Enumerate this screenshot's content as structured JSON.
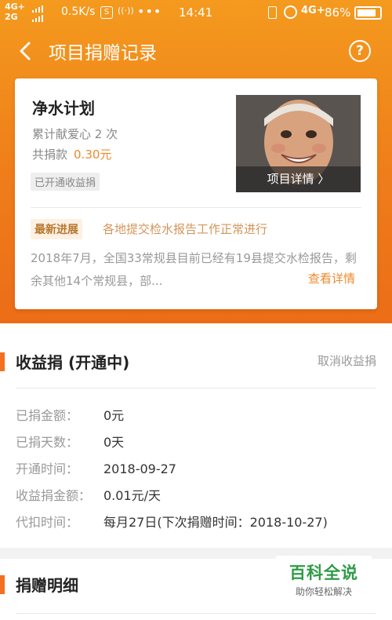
{
  "status_bar": {
    "network_top": "4G+",
    "network_bottom": "2G",
    "speed": "0.5K/s",
    "icon1": "S",
    "icon2": "((·))",
    "dots": "•••",
    "time": "14:41",
    "signal_right": "4G+",
    "battery_pct": "86%",
    "battery_level": 0.86
  },
  "nav": {
    "title": "项目捐赠记录",
    "help": "?"
  },
  "project": {
    "title": "净水计划",
    "love_count": "累计献爱心 2 次",
    "donated_label": "共捐款",
    "donated_amount": "0.30元",
    "tag": "已开通收益捐",
    "details_button": "项目详情 〉",
    "latest_tag": "最新进展",
    "latest_text": "各地提交检水报告工作正常进行",
    "description": "2018年7月，全国33常规县目前已经有19县提交水检报告，剩余其他14个常规县，部...",
    "more": "查看详情"
  },
  "earnings": {
    "title": "收益捐 (开通中)",
    "cancel": "取消收益捐",
    "rows": [
      {
        "label": "已捐金额：",
        "value": "0元"
      },
      {
        "label": "已捐天数：",
        "value": "0天"
      },
      {
        "label": "开通时间：",
        "value": "2018-09-27"
      },
      {
        "label": "收益捐金额：",
        "value": "0.01元/天"
      },
      {
        "label": "代扣时间：",
        "value": "每月27日(下次捐赠时间：2018-10-27)"
      }
    ]
  },
  "details": {
    "title": "捐赠明细"
  },
  "watermark": {
    "main": "百科全说",
    "sub": "助你轻松解决"
  },
  "colors": {
    "accent": "#f37021",
    "header_top": "#f49a1e",
    "header_bottom": "#ec6d17",
    "amount": "#ef8a2c"
  }
}
